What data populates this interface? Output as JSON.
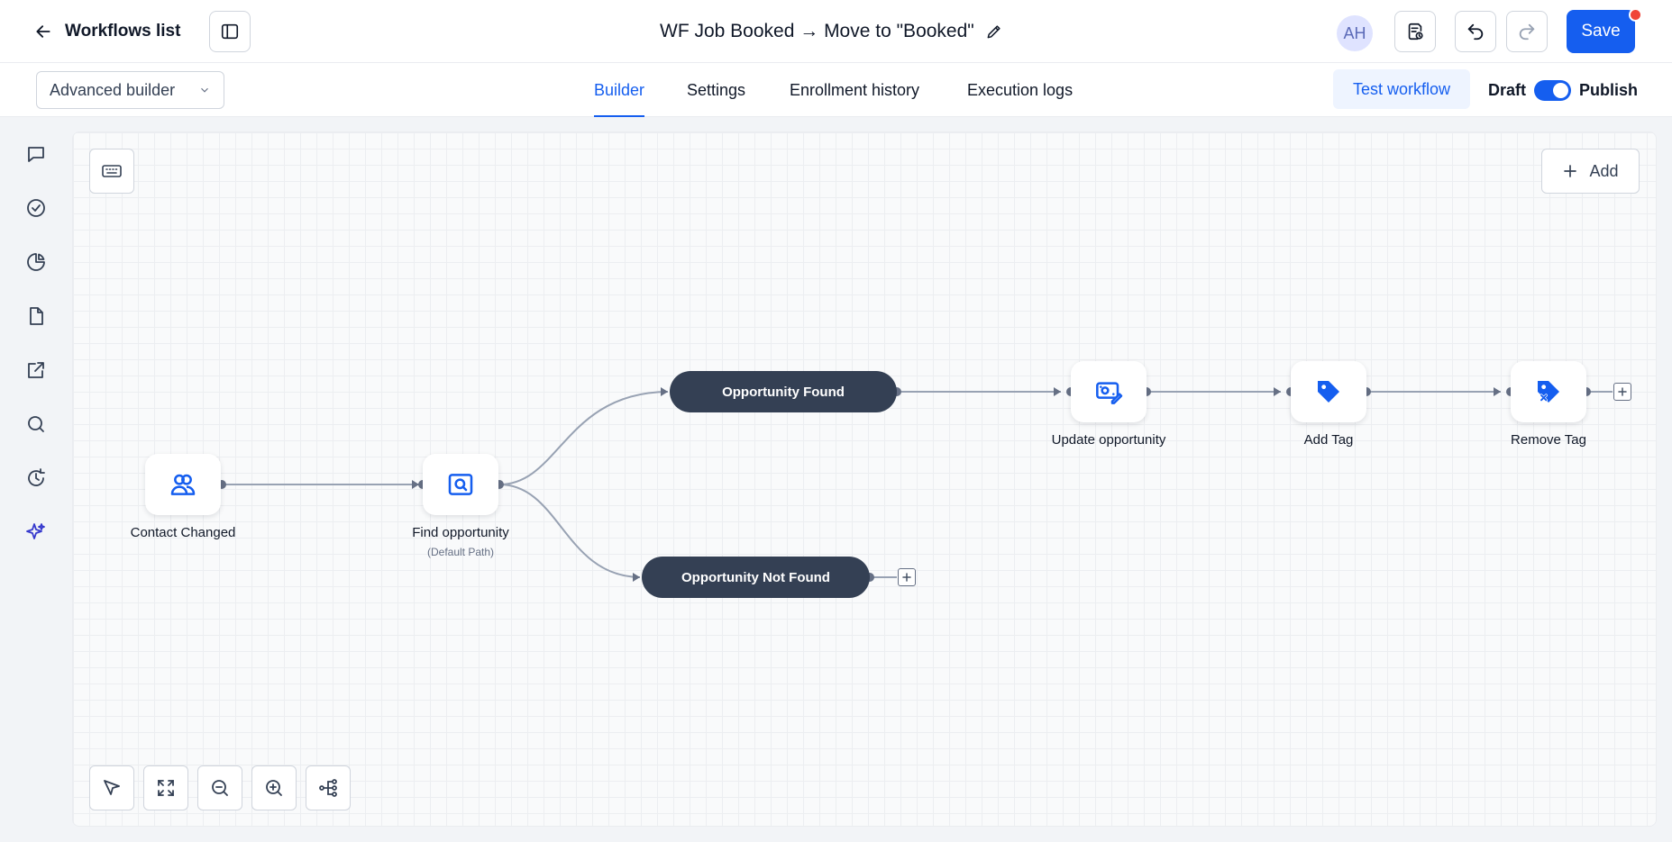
{
  "header": {
    "back_label": "Workflows list",
    "workflow_title": "WF Job Booked → Move to \"Booked\"",
    "avatar_initials": "AH",
    "save_label": "Save"
  },
  "subbar": {
    "builder_mode": "Advanced builder",
    "tabs": [
      {
        "label": "Builder",
        "active": true
      },
      {
        "label": "Settings",
        "active": false
      },
      {
        "label": "Enrollment history",
        "active": false
      },
      {
        "label": "Execution logs",
        "active": false
      }
    ],
    "test_label": "Test workflow",
    "draft_label": "Draft",
    "publish_label": "Publish"
  },
  "sidebar": {
    "icons": [
      "chat-icon",
      "check-circle-icon",
      "pie-chart-icon",
      "file-icon",
      "external-link-icon",
      "search-icon",
      "history-icon",
      "sparkle-icon"
    ]
  },
  "canvas": {
    "add_label": "Add",
    "trigger": {
      "label": "Contact Changed",
      "icon": "users-icon"
    },
    "find": {
      "label": "Find opportunity",
      "sublabel": "(Default Path)",
      "icon": "search-card-icon"
    },
    "branch_found": {
      "label": "Opportunity Found"
    },
    "branch_not_found": {
      "label": "Opportunity Not Found"
    },
    "actions": [
      {
        "label": "Update opportunity",
        "icon": "update-opportunity-icon"
      },
      {
        "label": "Add Tag",
        "icon": "tag-icon"
      },
      {
        "label": "Remove Tag",
        "icon": "tag-remove-icon"
      }
    ],
    "tools": [
      "pointer-icon",
      "fit-view-icon",
      "zoom-out-icon",
      "zoom-in-icon",
      "auto-layout-icon"
    ]
  },
  "colors": {
    "accent": "#155eef",
    "pill": "#344054",
    "icon": "#155eef",
    "save_badge": "#f04438"
  }
}
